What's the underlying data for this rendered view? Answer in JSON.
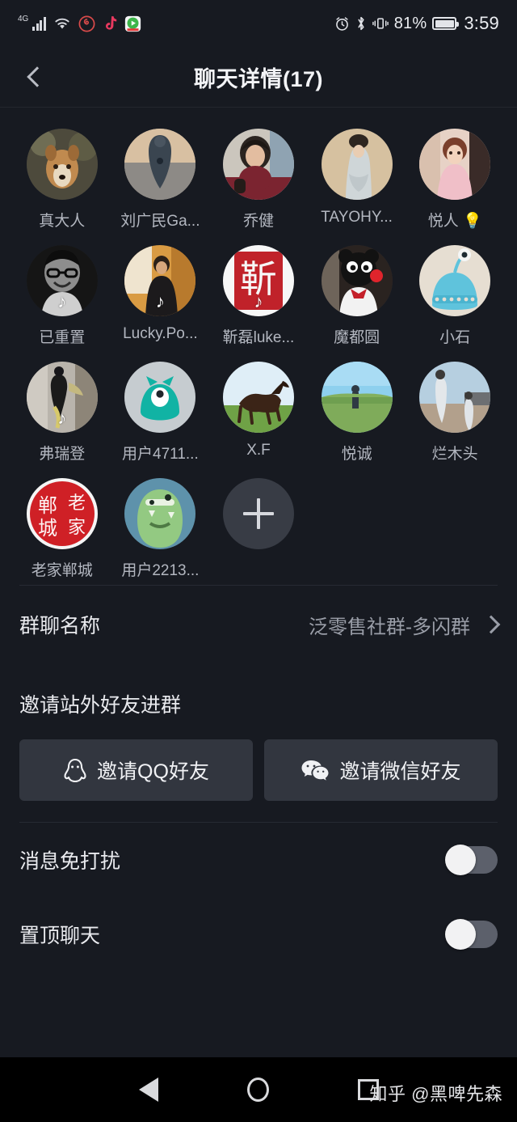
{
  "status_bar": {
    "network": "4G",
    "icons": [
      "signal-bars-icon",
      "wifi-icon",
      "netease-music-icon",
      "douyin-icon",
      "app-icon"
    ],
    "alarm": "alarm-icon",
    "bluetooth": "bluetooth-icon",
    "vibrate": "vibrate-icon",
    "battery_percent": "81%",
    "time": "3:59"
  },
  "header": {
    "back": "back-chevron",
    "title": "聊天详情(17)"
  },
  "members": [
    {
      "name": "真大人",
      "avatar": "dog-photo",
      "badge": ""
    },
    {
      "name": "刘广民Ga...",
      "avatar": "silhouette-sunset-photo",
      "badge": ""
    },
    {
      "name": "乔健",
      "avatar": "woman-photo",
      "badge": ""
    },
    {
      "name": "TAYOHY...",
      "avatar": "hanfu-portrait-photo",
      "badge": ""
    },
    {
      "name": "悦人 💡",
      "avatar": "retro-lady-photo",
      "badge": ""
    },
    {
      "name": "已重置",
      "avatar": "bw-man-glasses-photo",
      "badge": "douyin"
    },
    {
      "name": "Lucky.Po...",
      "avatar": "man-speaking-photo",
      "badge": "douyin"
    },
    {
      "name": "靳磊luke...",
      "avatar": "red-seal-logo",
      "badge": "douyin"
    },
    {
      "name": "魔都圆",
      "avatar": "kumamon-photo",
      "badge": ""
    },
    {
      "name": "小石",
      "avatar": "blue-monster-cartoon",
      "badge": ""
    },
    {
      "name": "弗瑞登",
      "avatar": "person-walking-photo",
      "badge": "douyin"
    },
    {
      "name": "用户4711...",
      "avatar": "teal-monster-cartoon",
      "badge": ""
    },
    {
      "name": "X.F",
      "avatar": "horse-photo",
      "badge": ""
    },
    {
      "name": "悦诚",
      "avatar": "field-sky-photo",
      "badge": ""
    },
    {
      "name": "烂木头",
      "avatar": "beach-people-photo",
      "badge": ""
    },
    {
      "name": "老家郸城",
      "avatar": "red-seal-laojia-logo",
      "badge": ""
    },
    {
      "name": "用户2213...",
      "avatar": "green-monster-cartoon",
      "badge": ""
    }
  ],
  "add_member": {
    "icon": "plus-icon",
    "label": ""
  },
  "group_name_row": {
    "label": "群聊名称",
    "value": "泛零售社群-多闪群",
    "chevron": "chevron-right-icon"
  },
  "invite": {
    "title": "邀请站外好友进群",
    "qq_button": {
      "label": "邀请QQ好友",
      "icon": "qq-penguin-icon"
    },
    "wechat_button": {
      "label": "邀请微信好友",
      "icon": "wechat-icon"
    }
  },
  "settings": [
    {
      "label": "消息免打扰",
      "state": "off"
    },
    {
      "label": "置顶聊天",
      "state": "off"
    }
  ],
  "nav_bar": {
    "back": "nav-back-triangle",
    "home": "nav-home-circle",
    "recents": "nav-recents-square"
  },
  "watermark": "知乎 @黑啤先森",
  "colors": {
    "background": "#171a21",
    "button": "#32363f",
    "accent_text": "#e9eaee",
    "muted_text": "#9a9ea8",
    "nav_background": "#000000"
  }
}
